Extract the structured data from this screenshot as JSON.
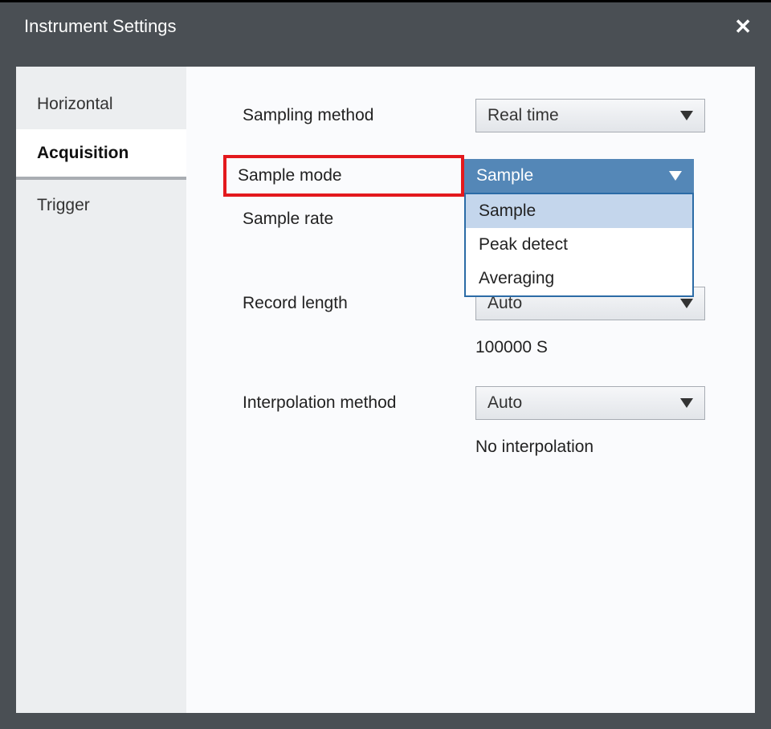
{
  "window": {
    "title": "Instrument Settings"
  },
  "sidebar": {
    "items": [
      {
        "label": "Horizontal",
        "active": false
      },
      {
        "label": "Acquisition",
        "active": true
      },
      {
        "label": "Trigger",
        "active": false
      }
    ]
  },
  "content": {
    "sampling_method": {
      "label": "Sampling method",
      "value": "Real time"
    },
    "sample_mode": {
      "label": "Sample mode",
      "value": "Sample",
      "options": [
        "Sample",
        "Peak detect",
        "Averaging"
      ]
    },
    "sample_rate": {
      "label": "Sample rate"
    },
    "record_length": {
      "label": "Record length",
      "value": "Auto",
      "detail": "100000 S"
    },
    "interpolation": {
      "label": "Interpolation method",
      "value": "Auto",
      "detail": "No interpolation"
    }
  }
}
